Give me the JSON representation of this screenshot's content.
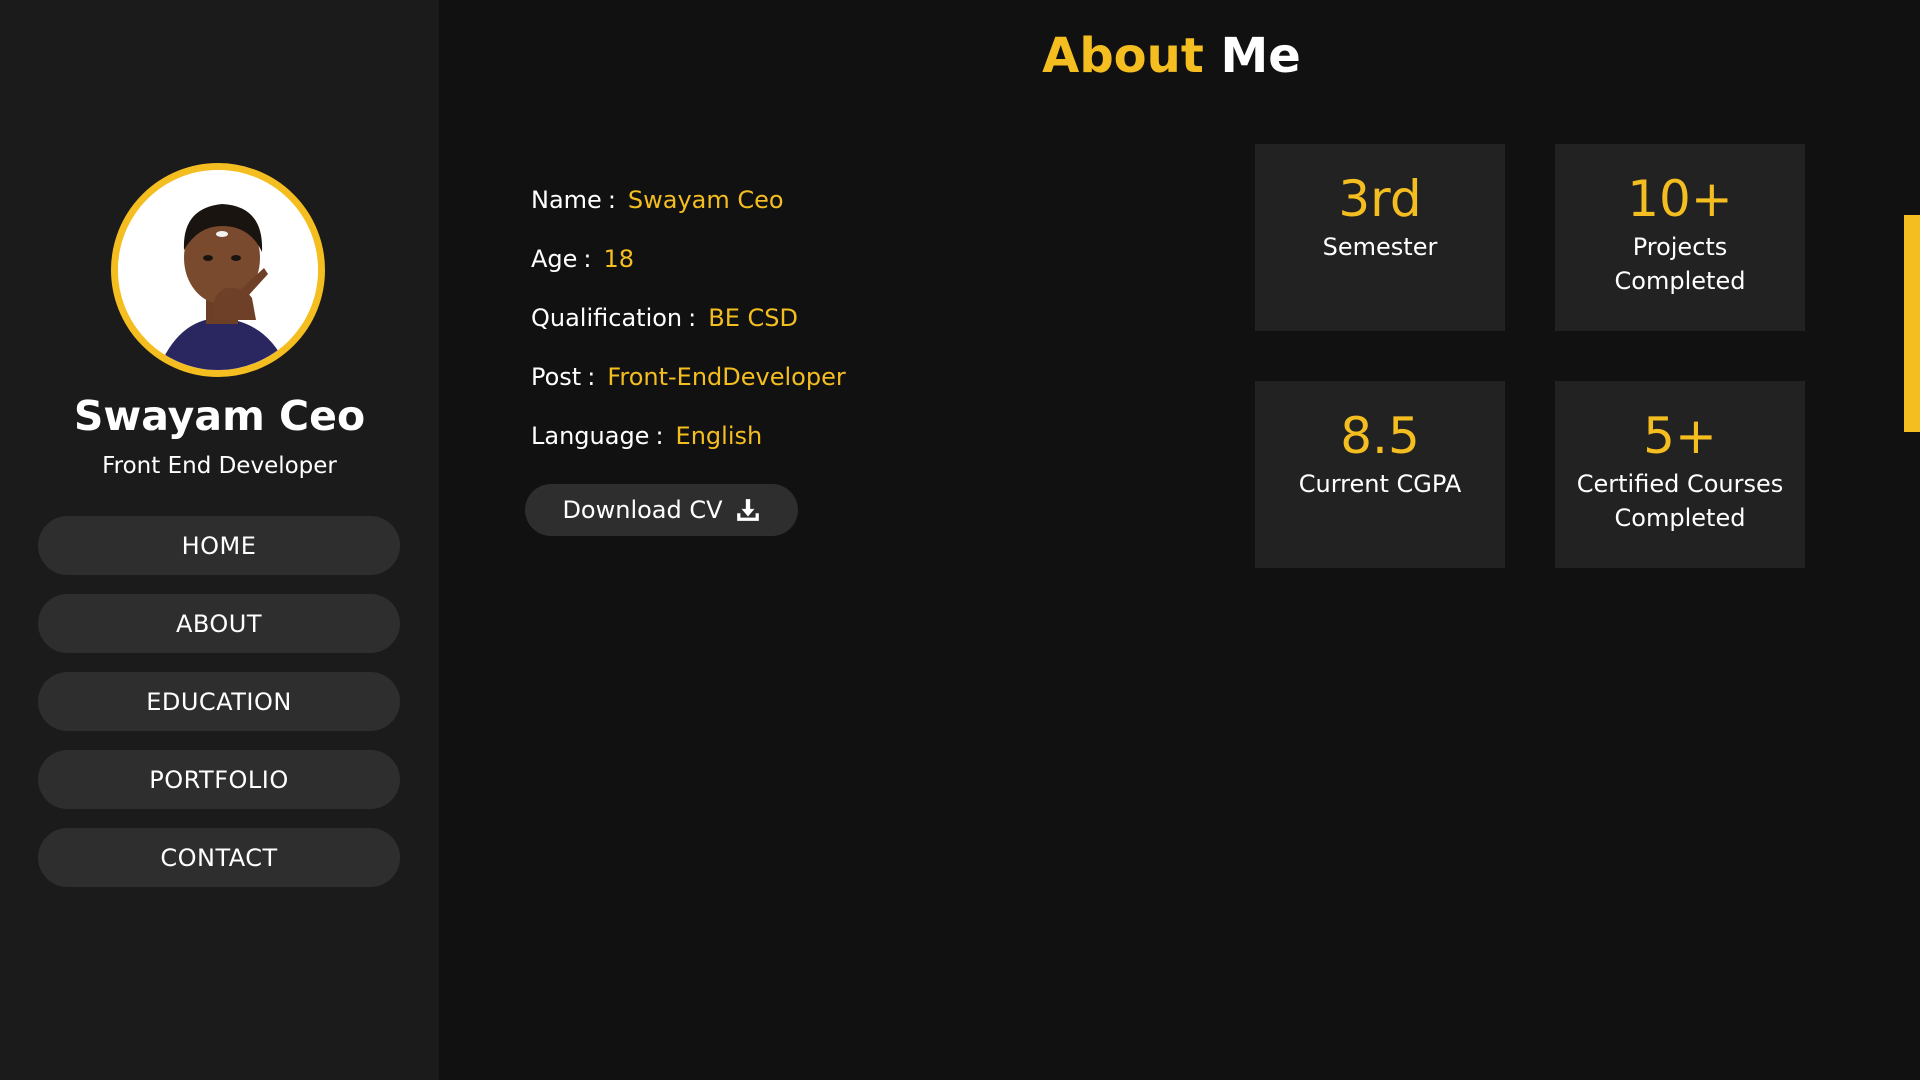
{
  "colors": {
    "accent": "#f4be20",
    "background": "#111111",
    "sidebar": "#1b1b1b",
    "card": "#222222",
    "button": "#2e2e2e"
  },
  "sidebar": {
    "avatar_icon": "profile-photo",
    "name": "Swayam Ceo",
    "role": "Front End Developer",
    "nav": [
      {
        "label": "HOME"
      },
      {
        "label": "ABOUT"
      },
      {
        "label": "EDUCATION"
      },
      {
        "label": "PORTFOLIO"
      },
      {
        "label": "CONTACT"
      }
    ]
  },
  "main": {
    "title_accent": "About",
    "title_rest": "Me",
    "info": [
      {
        "label": "Name",
        "value": "Swayam Ceo"
      },
      {
        "label": "Age",
        "value": "18"
      },
      {
        "label": "Qualification",
        "value": "BE CSD"
      },
      {
        "label": "Post",
        "value": "Front-EndDeveloper"
      },
      {
        "label": "Language",
        "value": "English"
      }
    ],
    "info_separator": ":",
    "cv_button": {
      "label": "Download CV",
      "icon": "download-icon"
    },
    "stats": [
      {
        "value": "3rd",
        "label": "Semester"
      },
      {
        "value": "10+",
        "label": "Projects Completed"
      },
      {
        "value": "8.5",
        "label": "Current CGPA"
      },
      {
        "value": "5+",
        "label": "Certified Courses Completed"
      }
    ]
  }
}
